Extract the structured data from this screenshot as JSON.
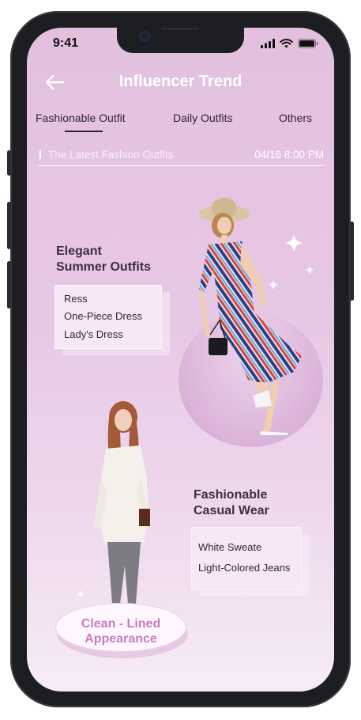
{
  "status_bar": {
    "time": "9:41"
  },
  "header": {
    "title": "Influencer Trend",
    "back_icon": "arrow-left-icon"
  },
  "tabs": [
    {
      "label": "Fashionable Outfit",
      "active": true
    },
    {
      "label": "Daily Outfits",
      "active": false
    },
    {
      "label": "Others",
      "active": false
    }
  ],
  "subbar": {
    "label": "The Latest Fashion Outfits",
    "datetime": "04/16 8:00 PM"
  },
  "section_summer": {
    "title_line1": "Elegant",
    "title_line2": "Summer Outfits",
    "items": [
      "Ress",
      "One-Piece Dress",
      "Lady's Dress"
    ]
  },
  "section_casual": {
    "title_line1": "Fashionable",
    "title_line2": "Casual Wear",
    "items": [
      "White Sweate",
      "Light-Colored Jeans"
    ]
  },
  "badge": {
    "line1": "Clean - Lined",
    "line2": "Appearance"
  },
  "colors": {
    "accent": "#c67cbf",
    "background_top": "#e2c0de",
    "text_dark": "#3b2e3c"
  }
}
